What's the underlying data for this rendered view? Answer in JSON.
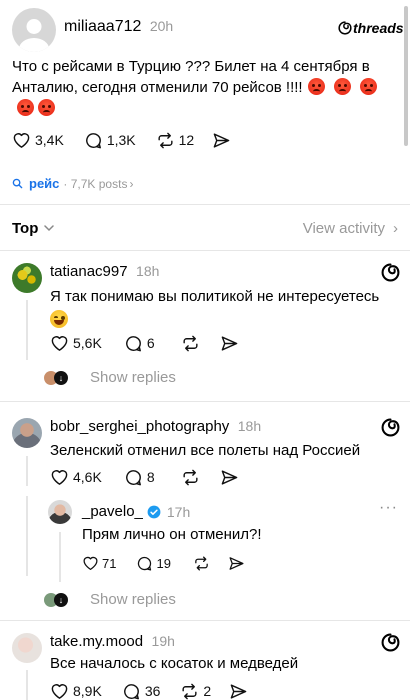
{
  "post": {
    "username": "miliaaa712",
    "time": "20h",
    "app_brand": "threads",
    "text": "Что с рейсами в Турцию ??? Билет на 4 сентября в Анталию, сегодня отменили 70 рейсов !!!!",
    "likes": "3,4K",
    "comments": "1,3K",
    "reposts": "12"
  },
  "topic": {
    "tag": "рейс",
    "posts": "· 7,7K posts"
  },
  "sort": {
    "label": "Top",
    "view_activity": "View activity"
  },
  "replies": [
    {
      "username": "tatianac997",
      "time": "18h",
      "text": "Я так понимаю вы политикой не интересуетесь",
      "likes": "5,6K",
      "comments": "6",
      "show_replies": "Show replies"
    },
    {
      "username": "bobr_serghei_photography",
      "time": "18h",
      "text": "Зеленский отменил все полеты над Россией",
      "likes": "4,6K",
      "comments": "8",
      "nested": {
        "username": "_pavelo_",
        "time": "17h",
        "text": "Прям лично он отменил?!",
        "likes": "71",
        "comments": "19"
      },
      "show_replies": "Show replies"
    },
    {
      "username": "take.my.mood",
      "time": "19h",
      "text": "Все началось с косаток и медведей",
      "likes": "8,9K",
      "comments": "36",
      "reposts": "2"
    }
  ],
  "colors": {
    "accent": "#1a73e8",
    "verified": "#1d9bf0",
    "muted": "#999999",
    "divider": "#e6e6e6"
  }
}
